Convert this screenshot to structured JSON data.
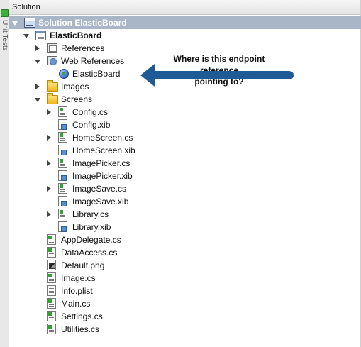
{
  "sidebar": {
    "vertical_label": "Unit Tests"
  },
  "panel": {
    "title": "Solution"
  },
  "tree": {
    "solution": "Solution ElasticBoard",
    "project": "ElasticBoard",
    "references": "References",
    "web_references": "Web References",
    "web_reference_item": "ElasticBoard",
    "images": "Images",
    "screens": "Screens",
    "screen_files": [
      "Config.cs",
      "Config.xib",
      "HomeScreen.cs",
      "HomeScreen.xib",
      "ImagePicker.cs",
      "ImagePicker.xib",
      "ImageSave.cs",
      "ImageSave.xib",
      "Library.cs",
      "Library.xib"
    ],
    "root_files": [
      "AppDelegate.cs",
      "DataAccess.cs",
      "Default.png",
      "Image.cs",
      "Info.plist",
      "Main.cs",
      "Settings.cs",
      "Utilities.cs"
    ]
  },
  "annotation": {
    "line1": "Where is this endpoint reference",
    "line2": "pointing to?"
  },
  "colors": {
    "selection": "#a9b6c8",
    "arrow": "#1f5a97"
  },
  "icons": {
    "solution": "solution-icon",
    "project": "project-icon",
    "folder": "folder-icon",
    "cs": "cs-file-icon",
    "xib": "xib-file-icon",
    "png": "png-file-icon",
    "plist": "plist-file-icon",
    "globe": "globe-icon"
  }
}
